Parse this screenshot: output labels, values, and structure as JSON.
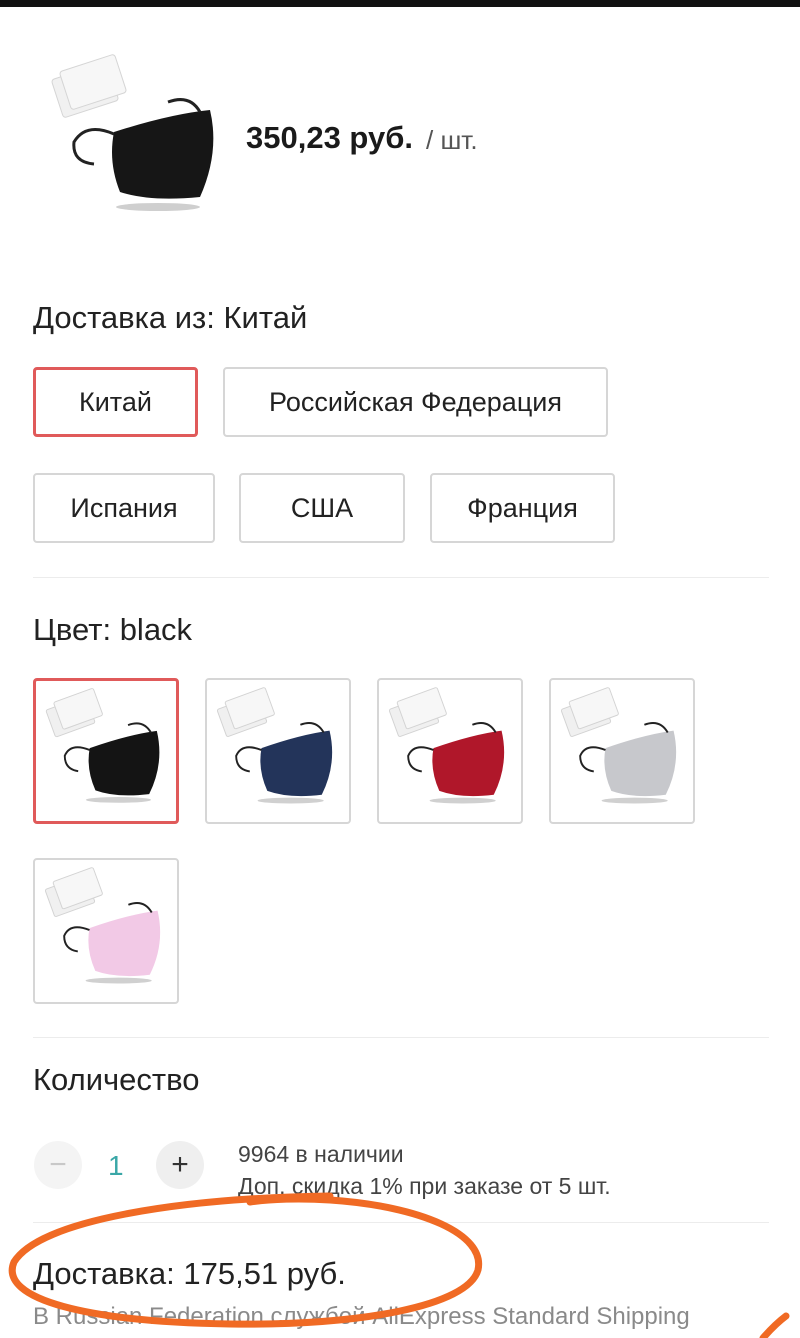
{
  "product": {
    "price": "350,23 руб.",
    "unit": "/ шт."
  },
  "ship_from": {
    "title": "Доставка из: Китай",
    "options": [
      "Китай",
      "Российская Федерация",
      "Испания",
      "США",
      "Франция"
    ],
    "selected": "Китай"
  },
  "color": {
    "title": "Цвет: black",
    "swatches": [
      {
        "name": "black",
        "hex": "#141414"
      },
      {
        "name": "navy",
        "hex": "#23345a"
      },
      {
        "name": "red",
        "hex": "#b0172a"
      },
      {
        "name": "gray",
        "hex": "#c7c8cc"
      },
      {
        "name": "pink",
        "hex": "#f2c9e6"
      }
    ],
    "selected": "black"
  },
  "quantity": {
    "title": "Количество",
    "minus": "−",
    "plus": "+",
    "value": "1",
    "stock": "9964 в наличии",
    "discount": "Доп. скидка 1% при заказе от 5 шт."
  },
  "shipping": {
    "cost": "Доставка: 175,51 руб.",
    "description": "В Russian Federation службой AliExpress Standard Shipping"
  },
  "colors": {
    "accent": "#e05a5a",
    "annotation": "#f06a24",
    "qty_value": "#3aa7a7"
  }
}
